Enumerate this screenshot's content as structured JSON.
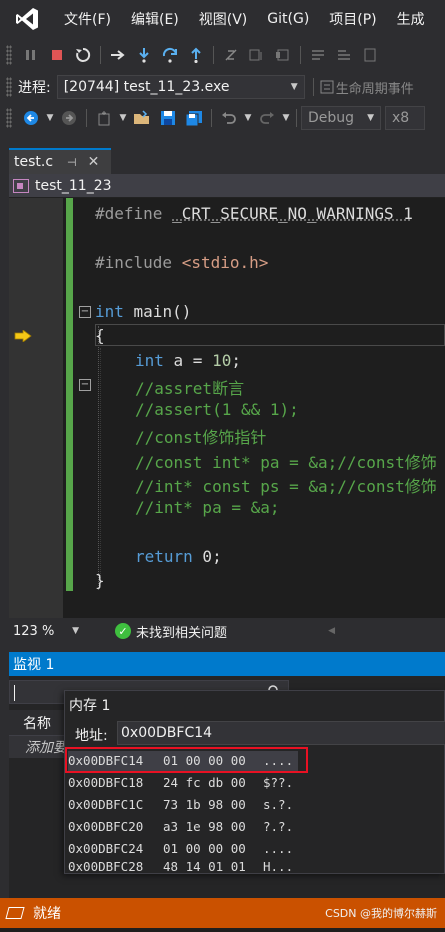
{
  "menu": {
    "items": [
      "文件(F)",
      "编辑(E)",
      "视图(V)",
      "Git(G)",
      "项目(P)",
      "生成"
    ]
  },
  "process_bar": {
    "label": "进程:",
    "process_value": "[20744] test_11_23.exe",
    "lifecycle_label": "生命周期事件"
  },
  "toolbar3": {
    "config_value": "Debug",
    "platform_value": "x8"
  },
  "document_tab": {
    "label": "test.c",
    "pin_icon": "pin-icon",
    "close_icon": "close-icon"
  },
  "nav_bar": {
    "project": "test_11_23"
  },
  "editor": {
    "lines": {
      "l1a": "#define ",
      "l1b": "_CRT_SECURE_NO_WARNINGS 1",
      "l2a": "#include ",
      "l2b": "<stdio.h>",
      "l3a": "int",
      "l3b": " main()",
      "l4": "{",
      "l5a": "int",
      "l5b": " a = ",
      "l5c": "10",
      "l5d": ";",
      "l6": "//assret断言",
      "l7": "//assert(1 && 1);",
      "l8": "//const修饰指针",
      "l9": "//const int* pa = &a;//const修饰",
      "l10": "//int* const ps = &a;//const修饰",
      "l11": "//int* pa = &a;",
      "l12a": "return",
      "l12b": " 0;",
      "l13": "}"
    },
    "zoom": "123 %",
    "issues": "未找到相关问题"
  },
  "watch": {
    "title": "监视 1",
    "column_name": "名称",
    "add_item": "添加要"
  },
  "memory": {
    "title": "内存 1",
    "address_label": "地址:",
    "address_value": "0x00DBFC14",
    "rows": [
      {
        "addr": "0x00DBFC14",
        "bytes": "01 00 00 00",
        "chars": "...."
      },
      {
        "addr": "0x00DBFC18",
        "bytes": "24 fc db 00",
        "chars": "$??."
      },
      {
        "addr": "0x00DBFC1C",
        "bytes": "73 1b 98 00",
        "chars": "s.?."
      },
      {
        "addr": "0x00DBFC20",
        "bytes": "a3 1e 98 00",
        "chars": "?.?."
      },
      {
        "addr": "0x00DBFC24",
        "bytes": "01 00 00 00",
        "chars": "...."
      },
      {
        "addr": "0x00DBFC28",
        "bytes": "48 14 01 01",
        "chars": "H..."
      }
    ]
  },
  "status": {
    "text": "就绪",
    "watermark": "CSDN @我的博尔赫斯"
  },
  "colors": {
    "accent": "#007acc",
    "status_bar": "#ca5100",
    "highlight_box": "#e81123",
    "change_bar": "#57a64a"
  }
}
